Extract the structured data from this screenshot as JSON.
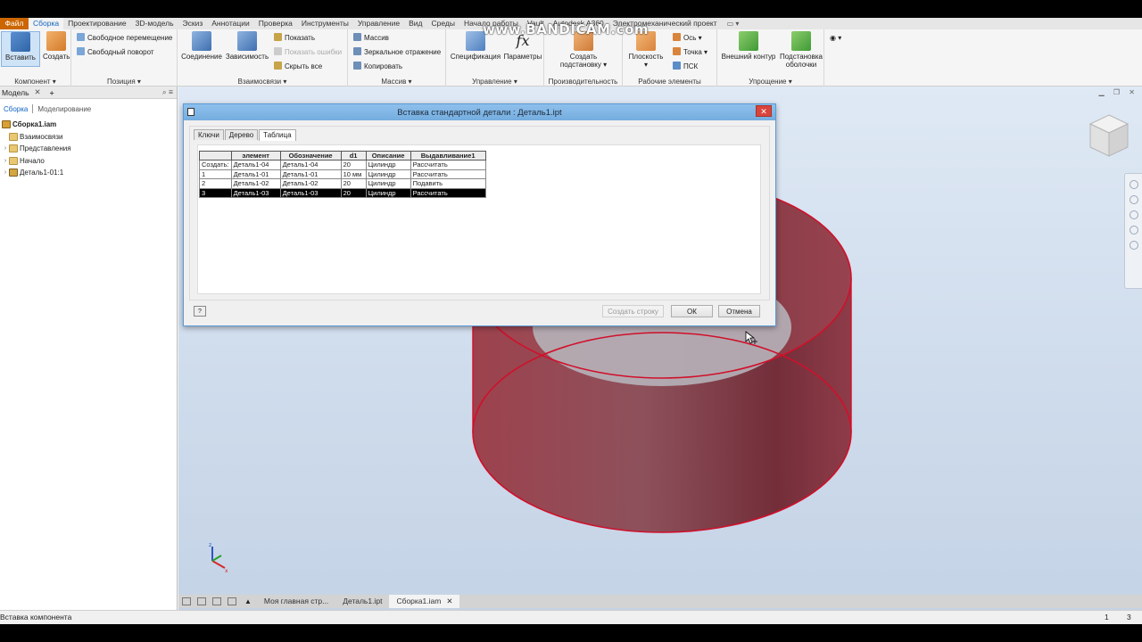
{
  "watermark": "www.BANDICAM.com",
  "tabs": [
    {
      "label": "Файл"
    },
    {
      "label": "Сборка"
    },
    {
      "label": "Проектирование"
    },
    {
      "label": "3D-модель"
    },
    {
      "label": "Эскиз"
    },
    {
      "label": "Аннотации"
    },
    {
      "label": "Проверка"
    },
    {
      "label": "Инструменты"
    },
    {
      "label": "Управление"
    },
    {
      "label": "Вид"
    },
    {
      "label": "Среды"
    },
    {
      "label": "Начало работы"
    },
    {
      "label": "Vault"
    },
    {
      "label": "Autodesk A360"
    },
    {
      "label": "Электромеханический проект"
    }
  ],
  "ribbon": {
    "component": {
      "title": "Компонент",
      "insert": "Вставить",
      "create": "Создать"
    },
    "position": {
      "title": "Позиция",
      "free_move": "Свободное перемещение",
      "free_rotate": "Свободный поворот"
    },
    "relations": {
      "title": "Взаимосвязи",
      "joint": "Соединение",
      "constraint": "Зависимость",
      "show": "Показать",
      "show_errors": "Показать ошибки",
      "hide_all": "Скрыть все"
    },
    "pattern": {
      "title": "Массив",
      "pattern": "Массив",
      "mirror": "Зеркальное отражение",
      "copy": "Копировать"
    },
    "manage": {
      "title": "Управление",
      "bom": "Спецификация",
      "params": "Параметры"
    },
    "productivity": {
      "title": "Производительность",
      "substitute_1": "Создать",
      "substitute_2": "подстановку"
    },
    "work": {
      "title": "Рабочие элементы",
      "plane": "Плоскость",
      "axis": "Ось",
      "point": "Точка",
      "ucs": "ПСК"
    },
    "simplify": {
      "title": "Упрощение",
      "shrinkwrap": "Внешний контур",
      "sub_1": "Подстановка",
      "sub_2": "оболочки"
    }
  },
  "browser": {
    "tab": "Модель",
    "mode_assembly": "Сборка",
    "mode_modeling": "Моделирование",
    "root": "Сборка1.iam",
    "items": [
      {
        "label": "Взаимосвязи"
      },
      {
        "label": "Представления"
      },
      {
        "label": "Начало"
      },
      {
        "label": "Деталь1-01:1"
      }
    ]
  },
  "dialog": {
    "title": "Вставка стандартной детали : Деталь1.ipt",
    "tabs": [
      "Ключи",
      "Дерево",
      "Таблица"
    ],
    "columns": [
      "",
      "элемент",
      "Обозначение",
      "d1",
      "Описание",
      "Выдавливание1"
    ],
    "rows": [
      [
        "Создать:",
        "Деталь1-04",
        "Деталь1-04",
        "20",
        "Цилиндр",
        "Рассчитать"
      ],
      [
        "1",
        "Деталь1-01",
        "Деталь1-01",
        "10 мм",
        "Цилиндр",
        "Рассчитать"
      ],
      [
        "2",
        "Деталь1-02",
        "Деталь1-02",
        "20",
        "Цилиндр",
        "Подавить"
      ],
      [
        "3",
        "Деталь1-03",
        "Деталь1-03",
        "20",
        "Цилиндр",
        "Рассчитать"
      ]
    ],
    "create_row": "Создать строку",
    "ok": "ОК",
    "cancel": "Отмена"
  },
  "doc_tabs": [
    {
      "label": "Моя главная стр..."
    },
    {
      "label": "Деталь1.ipt"
    },
    {
      "label": "Сборка1.iam"
    }
  ],
  "status": {
    "text": "Вставка компонента",
    "n1": "1",
    "n2": "3"
  },
  "colors": {
    "accent": "#1565c0",
    "file_tab": "#cc6600",
    "cylinder_edge": "#d0102a",
    "cylinder_fill": "#a0303c"
  }
}
